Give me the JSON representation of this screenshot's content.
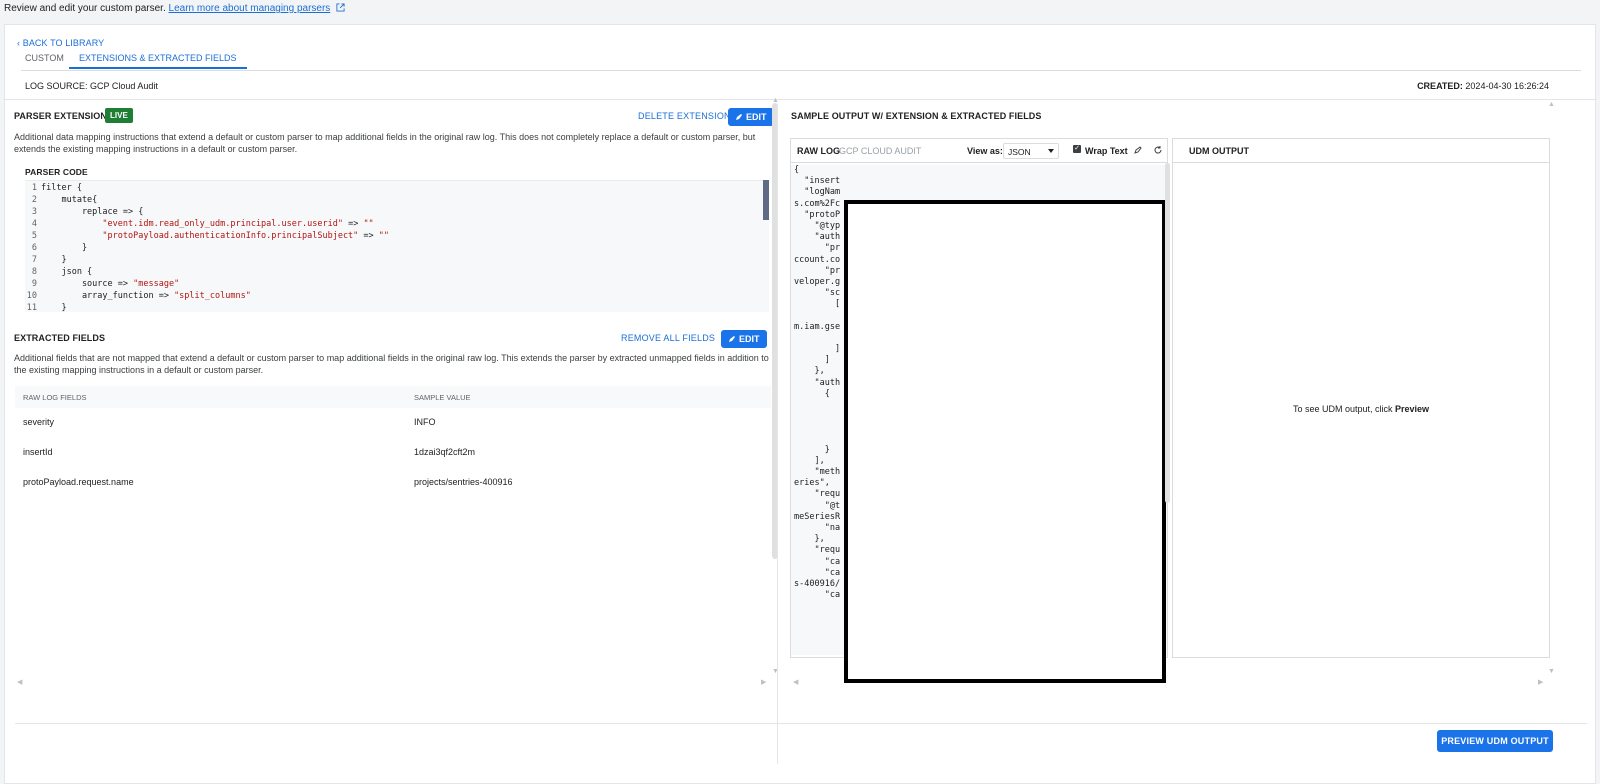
{
  "topbar": {
    "text": "Review and edit your custom parser.",
    "link": "Learn more about managing parsers"
  },
  "nav": {
    "back": "BACK TO LIBRARY"
  },
  "tabs": [
    {
      "label": "CUSTOM",
      "active": false
    },
    {
      "label": "EXTENSIONS & EXTRACTED FIELDS",
      "active": true
    }
  ],
  "meta": {
    "log_source_label": "LOG SOURCE:",
    "log_source_value": "GCP Cloud Audit",
    "created_label": "CREATED:",
    "created_value": "2024-04-30 16:26:24"
  },
  "parser_extensions": {
    "title": "PARSER EXTENSIONS",
    "badge": "LIVE",
    "delete_label": "DELETE EXTENSION",
    "edit_label": "EDIT",
    "description": "Additional data mapping instructions that extend a default or custom parser to map additional fields in the original raw log. This does not completely replace a default or custom parser, but extends the existing mapping instructions in a default or custom parser.",
    "code_title": "PARSER CODE",
    "code_lines": [
      {
        "n": "1",
        "t": "filter {"
      },
      {
        "n": "2",
        "t": "    mutate{"
      },
      {
        "n": "3",
        "t": "        replace => {"
      },
      {
        "n": "4",
        "t": "            \"event.idm.read_only_udm.principal.user.userid\" => \"\""
      },
      {
        "n": "5",
        "t": "            \"protoPayload.authenticationInfo.principalSubject\" => \"\""
      },
      {
        "n": "6",
        "t": "        }"
      },
      {
        "n": "7",
        "t": "    }"
      },
      {
        "n": "8",
        "t": "    json {"
      },
      {
        "n": "9",
        "t": "        source => \"message\""
      },
      {
        "n": "10",
        "t": "        array_function => \"split_columns\""
      },
      {
        "n": "11",
        "t": "    }"
      }
    ]
  },
  "extracted_fields": {
    "title": "EXTRACTED FIELDS",
    "remove_label": "REMOVE ALL FIELDS",
    "edit_label": "EDIT",
    "description": "Additional fields that are not mapped that extend a default or custom parser to map additional fields in the original raw log. This extends the parser by extracted unmapped fields in addition to the existing mapping instructions in a default or custom parser.",
    "columns": [
      "RAW LOG FIELDS",
      "SAMPLE VALUE"
    ],
    "rows": [
      [
        "severity",
        "INFO"
      ],
      [
        "insertId",
        "1dzai3qf2cft2m"
      ],
      [
        "protoPayload.request.name",
        "projects/sentries-400916"
      ]
    ]
  },
  "sample_output": {
    "title": "SAMPLE OUTPUT W/ EXTENSION & EXTRACTED FIELDS",
    "raw_log_label": "RAW LOG",
    "raw_log_source": "GCP CLOUD AUDIT",
    "view_as_label": "View as:",
    "view_as_value": "JSON",
    "wrap_label": "Wrap Text",
    "raw_lines": [
      "{",
      "  \"insert",
      "  \"logNam",
      "s.com%2Fc",
      "  \"protoP",
      "    \"@typ",
      "    \"auth",
      "      \"pr",
      "ccount.co",
      "      \"pr",
      "veloper.g",
      "      \"sc",
      "        [",
      "",
      "m.iam.gse",
      "",
      "        ]",
      "      ]",
      "    },",
      "    \"auth",
      "      {",
      "",
      "",
      "",
      "",
      "      }",
      "    ],",
      "    \"meth",
      "eries\",",
      "    \"requ",
      "      \"@t",
      "meSeriesR",
      "      \"na",
      "    },",
      "    \"requ",
      "      \"ca",
      "      \"ca",
      "s-400916/",
      "      \"ca"
    ],
    "udm_title": "UDM OUTPUT",
    "udm_hint_prefix": "To see UDM output, click",
    "udm_hint_action": "Preview"
  },
  "footer": {
    "preview_label": "PREVIEW UDM OUTPUT"
  }
}
